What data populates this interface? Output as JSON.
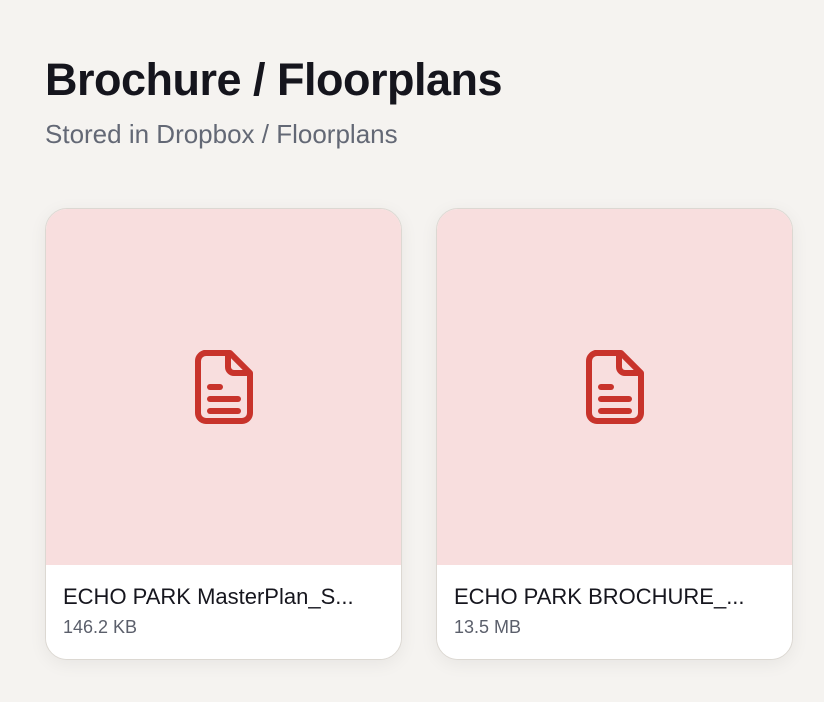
{
  "header": {
    "title": "Brochure / Floorplans",
    "subtitle": "Stored in Dropbox / Floorplans"
  },
  "colors": {
    "background": "#f5f3f0",
    "preview_bg": "#f8dede",
    "icon": "#c8332b"
  },
  "files": [
    {
      "name": "ECHO PARK MasterPlan_S...",
      "size": "146.2 KB",
      "icon": "document-icon"
    },
    {
      "name": "ECHO PARK BROCHURE_...",
      "size": "13.5 MB",
      "icon": "document-icon"
    }
  ]
}
